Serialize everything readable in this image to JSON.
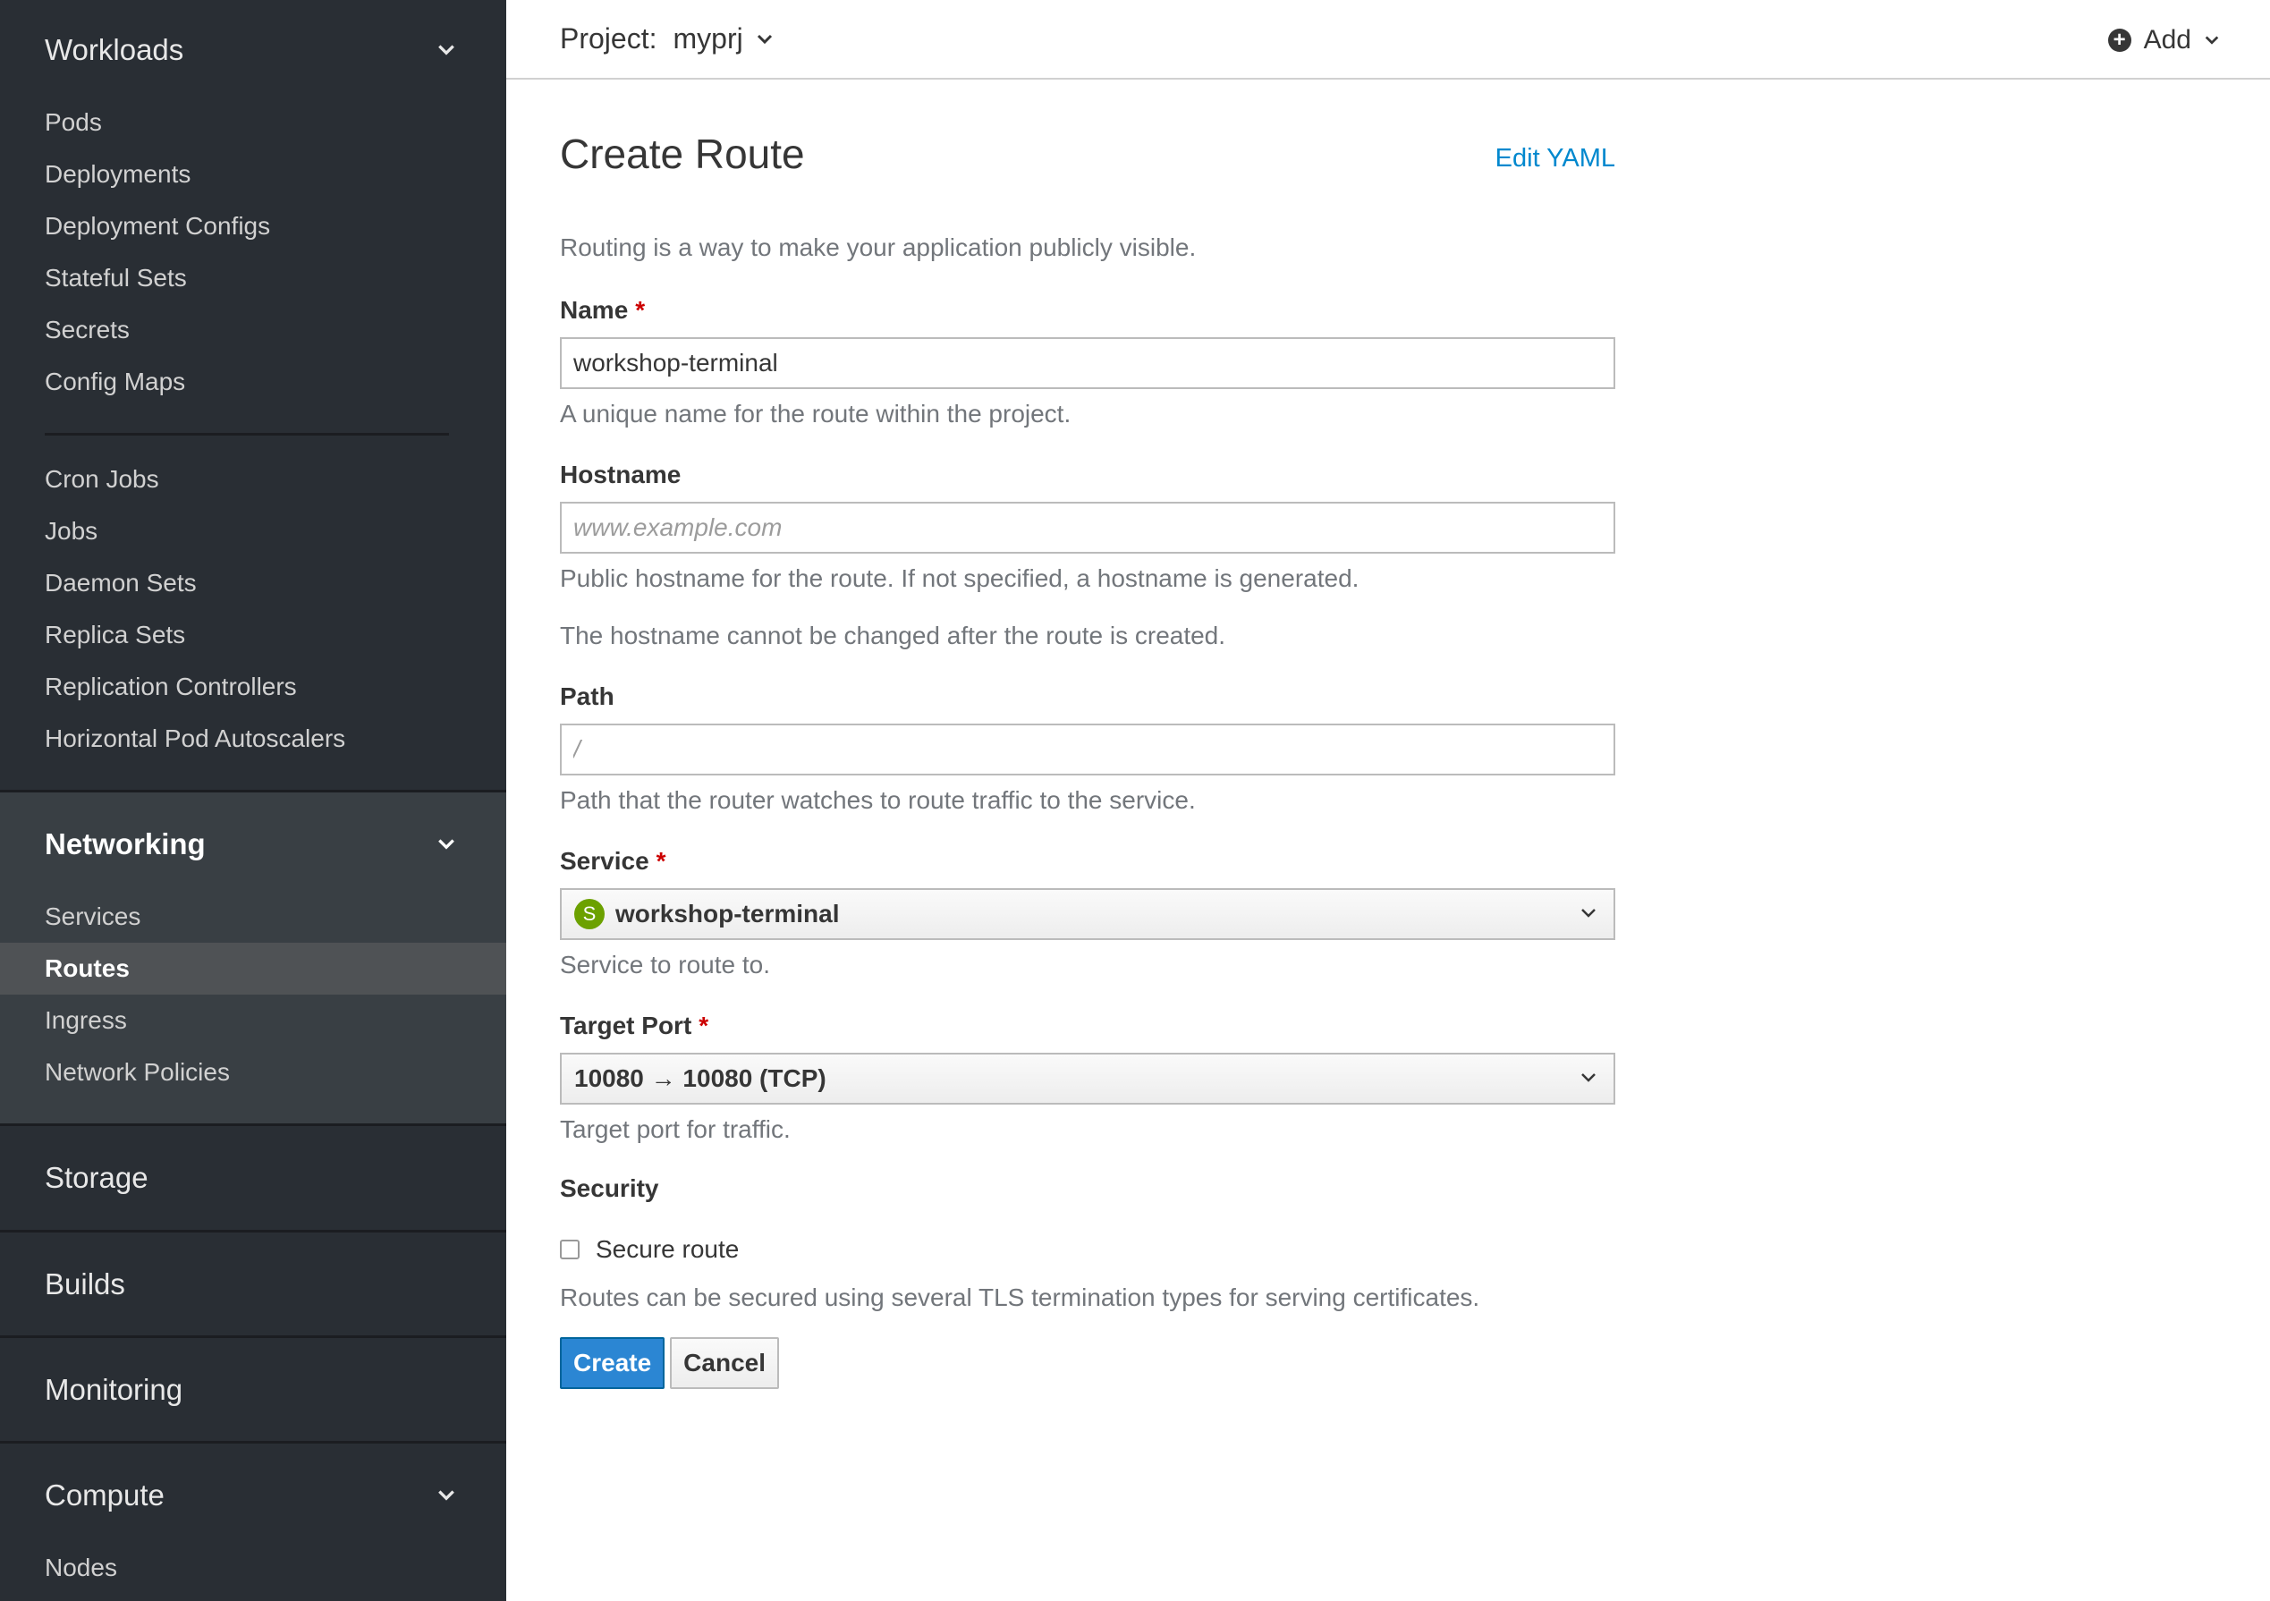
{
  "sidebar": {
    "workloads": {
      "title": "Workloads",
      "items_a": [
        "Pods",
        "Deployments",
        "Deployment Configs",
        "Stateful Sets",
        "Secrets",
        "Config Maps"
      ],
      "items_b": [
        "Cron Jobs",
        "Jobs",
        "Daemon Sets",
        "Replica Sets",
        "Replication Controllers",
        "Horizontal Pod Autoscalers"
      ]
    },
    "networking": {
      "title": "Networking",
      "items": [
        "Services",
        "Routes",
        "Ingress",
        "Network Policies"
      ],
      "selected": "Routes"
    },
    "storage": {
      "title": "Storage"
    },
    "builds": {
      "title": "Builds"
    },
    "monitoring": {
      "title": "Monitoring"
    },
    "compute": {
      "title": "Compute",
      "items": [
        "Nodes"
      ]
    }
  },
  "topbar": {
    "project_label": "Project:",
    "project_name": "myprj",
    "add_label": "Add"
  },
  "page": {
    "title": "Create Route",
    "edit_yaml": "Edit YAML",
    "intro": "Routing is a way to make your application publicly visible."
  },
  "form": {
    "name": {
      "label": "Name",
      "required": "*",
      "value": "workshop-terminal",
      "help": "A unique name for the route within the project."
    },
    "hostname": {
      "label": "Hostname",
      "placeholder": "www.example.com",
      "help": "Public hostname for the route. If not specified, a hostname is generated.",
      "help2": "The hostname cannot be changed after the route is created."
    },
    "path": {
      "label": "Path",
      "placeholder": "/",
      "help": "Path that the router watches to route traffic to the service."
    },
    "service": {
      "label": "Service",
      "required": "*",
      "badge": "S",
      "value": "workshop-terminal",
      "help": "Service to route to."
    },
    "target_port": {
      "label": "Target Port",
      "required": "*",
      "value": "10080 → 10080 (TCP)",
      "help": "Target port for traffic."
    },
    "security": {
      "label": "Security",
      "checkbox_label": "Secure route",
      "checked": false,
      "help": "Routes can be secured using several TLS termination types for serving certificates."
    },
    "buttons": {
      "create": "Create",
      "cancel": "Cancel"
    }
  },
  "colors": {
    "sidebar_bg": "#292e34",
    "sidebar_active_bg": "#393f44",
    "selected_item_bg": "#4f5255",
    "link": "#0088ce",
    "primary": "#2b86d3",
    "required": "#cc0000",
    "service_badge": "#6ca100"
  },
  "icons": {
    "section_expand": "chevron-down-icon",
    "add": "plus-circle-icon",
    "select_caret": "chevron-down-icon"
  }
}
